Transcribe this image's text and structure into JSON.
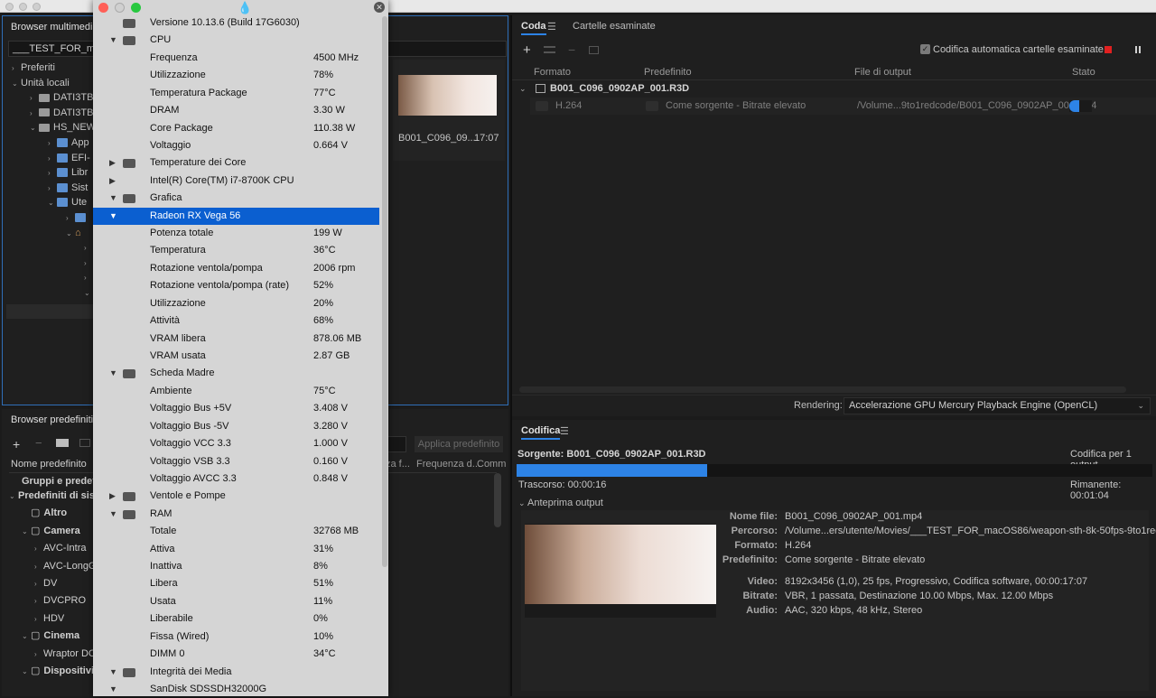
{
  "window": {
    "title_left": "Browser multimediale",
    "search_value": "___TEST_FOR_macOS"
  },
  "media_tree": [
    {
      "label": "Preferiti",
      "depth": 0,
      "exp": "›",
      "icon": "none"
    },
    {
      "label": "Unità locali",
      "depth": 0,
      "exp": "⌄",
      "icon": "none"
    },
    {
      "label": "DATI3TB",
      "depth": 1,
      "exp": "›",
      "icon": "drive"
    },
    {
      "label": "DATI3TB",
      "depth": 1,
      "exp": "›",
      "icon": "drive"
    },
    {
      "label": "HS_NEW",
      "depth": 1,
      "exp": "⌄",
      "icon": "drive"
    },
    {
      "label": "App",
      "depth": 2,
      "exp": "›",
      "icon": "folder"
    },
    {
      "label": "EFI-",
      "depth": 2,
      "exp": "›",
      "icon": "folder"
    },
    {
      "label": "Libr",
      "depth": 2,
      "exp": "›",
      "icon": "folder"
    },
    {
      "label": "Sist",
      "depth": 2,
      "exp": "›",
      "icon": "folder"
    },
    {
      "label": "Ute",
      "depth": 2,
      "exp": "⌄",
      "icon": "folder"
    },
    {
      "label": "",
      "depth": 3,
      "exp": "›",
      "icon": "folder"
    },
    {
      "label": "",
      "depth": 3,
      "exp": "⌄",
      "icon": "home"
    },
    {
      "label": "",
      "depth": 4,
      "exp": "›",
      "icon": "none"
    },
    {
      "label": "",
      "depth": 4,
      "exp": "›",
      "icon": "none"
    },
    {
      "label": "",
      "depth": 4,
      "exp": "›",
      "icon": "none"
    },
    {
      "label": "",
      "depth": 4,
      "exp": "⌄",
      "icon": "none"
    }
  ],
  "thumb": {
    "name": "B001_C096_09...",
    "duration": "17:07"
  },
  "presets": {
    "title": "Browser predefiniti",
    "search_value": "",
    "apply_label": "Applica predefinito",
    "columns": [
      "Nome predefinito",
      "Gruppi e predefin",
      "za f...",
      "Frequenza d...",
      "Comm"
    ],
    "tree": [
      {
        "label": "Predefiniti di sist",
        "depth": 0,
        "exp": "⌄"
      },
      {
        "label": "Altro",
        "depth": 1,
        "exp": ""
      },
      {
        "label": "Camera",
        "depth": 1,
        "exp": "⌄"
      },
      {
        "label": "AVC-Intra",
        "depth": 2,
        "exp": "›"
      },
      {
        "label": "AVC-LongG",
        "depth": 2,
        "exp": "›"
      },
      {
        "label": "DV",
        "depth": 2,
        "exp": "›"
      },
      {
        "label": "DVCPRO",
        "depth": 2,
        "exp": "›"
      },
      {
        "label": "HDV",
        "depth": 2,
        "exp": "›"
      },
      {
        "label": "Cinema",
        "depth": 1,
        "exp": "⌄"
      },
      {
        "label": "Wraptor DC",
        "depth": 2,
        "exp": "›"
      },
      {
        "label": "Dispositivi",
        "depth": 1,
        "exp": "⌄"
      }
    ]
  },
  "queue": {
    "tabs": [
      "Coda",
      "Cartelle esaminate"
    ],
    "auto_label": "Codifica automatica cartelle esaminate",
    "columns": [
      "Formato",
      "Predefinito",
      "File di output",
      "Stato"
    ],
    "group": "B001_C096_0902AP_001.R3D",
    "item": {
      "format": "H.264",
      "preset": "Come sorgente - Bitrate elevato",
      "output": "/Volume...9to1redcode/B001_C096_0902AP_001.mp4",
      "progress": 0.45
    },
    "render_label": "Rendering:",
    "render_value": "Accelerazione GPU Mercury Playback Engine (OpenCL)"
  },
  "encode": {
    "title": "Codifica",
    "source": "Sorgente: B001_C096_0902AP_001.R3D",
    "count": "Codifica per 1 output",
    "progress": 0.3,
    "elapsed": "Trascorso: 00:00:16",
    "remaining": "Rimanente: 00:01:04",
    "preview_label": "Anteprima output",
    "info": [
      {
        "k": "Nome file:",
        "v": "B001_C096_0902AP_001.mp4"
      },
      {
        "k": "Percorso:",
        "v": "/Volume...ers/utente/Movies/___TEST_FOR_macOS86/weapon-sth-8k-50fps-9to1redcode/"
      },
      {
        "k": "Formato:",
        "v": "H.264"
      },
      {
        "k": "Predefinito:",
        "v": "Come sorgente - Bitrate elevato"
      },
      {
        "k": "Video:",
        "v": "8192x3456 (1,0), 25 fps, Progressivo, Codifica software, 00:00:17:07"
      },
      {
        "k": "Bitrate:",
        "v": "VBR, 1 passata, Destinazione 10.00 Mbps, Max. 12.00 Mbps"
      },
      {
        "k": "Audio:",
        "v": "AAC, 320 kbps, 48 kHz, Stereo"
      }
    ]
  },
  "popup": {
    "rows": [
      {
        "label": "Versione 10.13.6 (Build 17G6030)",
        "value": "",
        "exp": "",
        "icon": "mac-icon"
      },
      {
        "label": "CPU",
        "value": "",
        "exp": "▼",
        "icon": "cpu-icon"
      },
      {
        "label": "Frequenza",
        "value": "4500 MHz",
        "exp": "",
        "icon": ""
      },
      {
        "label": "Utilizzazione",
        "value": "78%",
        "exp": "",
        "icon": ""
      },
      {
        "label": "Temperatura Package",
        "value": "77°C",
        "exp": "",
        "icon": ""
      },
      {
        "label": "DRAM",
        "value": "3.30 W",
        "exp": "",
        "icon": ""
      },
      {
        "label": "Core Package",
        "value": "110.38 W",
        "exp": "",
        "icon": ""
      },
      {
        "label": "Voltaggio",
        "value": "0.664 V",
        "exp": "",
        "icon": ""
      },
      {
        "label": "Temperature dei Core",
        "value": "",
        "exp": "▶",
        "icon": "thermometer-icon"
      },
      {
        "label": "Intel(R) Core(TM) i7-8700K CPU",
        "value": "",
        "exp": "▶",
        "icon": ""
      },
      {
        "label": "Grafica",
        "value": "",
        "exp": "▼",
        "icon": "gpu-icon"
      },
      {
        "label": "Radeon RX Vega 56",
        "value": "",
        "exp": "▼",
        "icon": "",
        "selected": true
      },
      {
        "label": "Potenza totale",
        "value": "199 W",
        "exp": "",
        "icon": ""
      },
      {
        "label": "Temperatura",
        "value": "36°C",
        "exp": "",
        "icon": ""
      },
      {
        "label": "Rotazione ventola/pompa",
        "value": "2006 rpm",
        "exp": "",
        "icon": ""
      },
      {
        "label": "Rotazione ventola/pompa (rate)",
        "value": "52%",
        "exp": "",
        "icon": ""
      },
      {
        "label": "Utilizzazione",
        "value": "20%",
        "exp": "",
        "icon": ""
      },
      {
        "label": "Attività",
        "value": "68%",
        "exp": "",
        "icon": ""
      },
      {
        "label": "VRAM libera",
        "value": "878.06 MB",
        "exp": "",
        "icon": ""
      },
      {
        "label": "VRAM usata",
        "value": "2.87 GB",
        "exp": "",
        "icon": ""
      },
      {
        "label": "Scheda Madre",
        "value": "",
        "exp": "▼",
        "icon": "motherboard-icon"
      },
      {
        "label": "Ambiente",
        "value": "75°C",
        "exp": "",
        "icon": ""
      },
      {
        "label": "Voltaggio Bus +5V",
        "value": "3.408 V",
        "exp": "",
        "icon": ""
      },
      {
        "label": "Voltaggio Bus -5V",
        "value": "3.280 V",
        "exp": "",
        "icon": ""
      },
      {
        "label": "Voltaggio VCC 3.3",
        "value": "1.000 V",
        "exp": "",
        "icon": ""
      },
      {
        "label": "Voltaggio VSB 3.3",
        "value": "0.160 V",
        "exp": "",
        "icon": ""
      },
      {
        "label": "Voltaggio AVCC 3.3",
        "value": "0.848 V",
        "exp": "",
        "icon": ""
      },
      {
        "label": "Ventole e Pompe",
        "value": "",
        "exp": "▶",
        "icon": "fan-icon"
      },
      {
        "label": "RAM",
        "value": "",
        "exp": "▼",
        "icon": "ram-icon"
      },
      {
        "label": "Totale",
        "value": "32768 MB",
        "exp": "",
        "icon": ""
      },
      {
        "label": "Attiva",
        "value": "31%",
        "exp": "",
        "icon": ""
      },
      {
        "label": "Inattiva",
        "value": "8%",
        "exp": "",
        "icon": ""
      },
      {
        "label": "Libera",
        "value": "51%",
        "exp": "",
        "icon": ""
      },
      {
        "label": "Usata",
        "value": "11%",
        "exp": "",
        "icon": ""
      },
      {
        "label": "Liberabile",
        "value": "0%",
        "exp": "",
        "icon": ""
      },
      {
        "label": "Fissa (Wired)",
        "value": "10%",
        "exp": "",
        "icon": ""
      },
      {
        "label": "DIMM 0",
        "value": "34°C",
        "exp": "",
        "icon": ""
      },
      {
        "label": "Integrità dei Media",
        "value": "",
        "exp": "▼",
        "icon": "disk-icon"
      },
      {
        "label": "SanDisk SDSSDH32000G",
        "value": "",
        "exp": "▼",
        "icon": ""
      }
    ]
  },
  "colors": {
    "accent": "#2d83e6",
    "selection": "#0b5fd0",
    "close_red": "#ff5f57",
    "min_yellow": "#febc2e",
    "max_green": "#28c840",
    "stop_red": "#e02020"
  }
}
